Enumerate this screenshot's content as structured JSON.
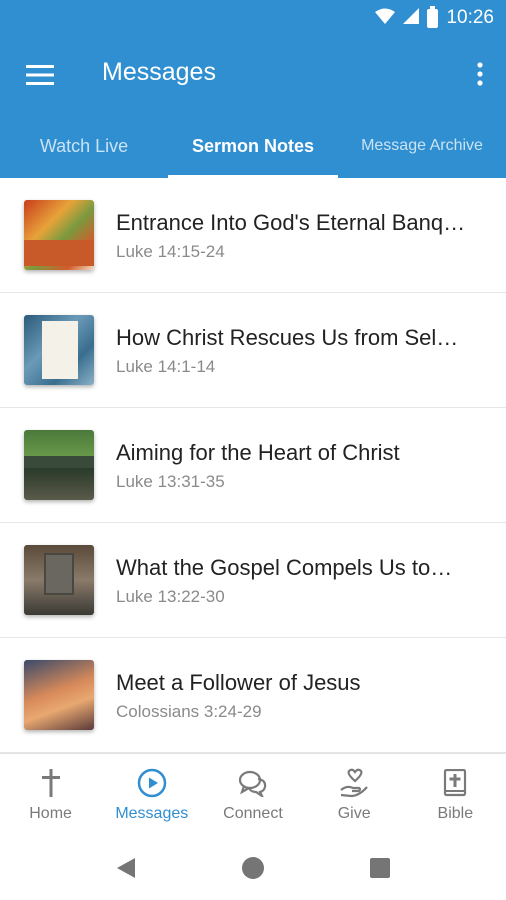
{
  "status_bar": {
    "time": "10:26",
    "icons": [
      "wifi-icon",
      "signal-icon",
      "battery-icon"
    ]
  },
  "app_bar": {
    "title": "Messages",
    "menu_icon": "hamburger-menu-icon",
    "overflow_icon": "more-vertical-icon"
  },
  "tabs": [
    {
      "label": "Watch Live",
      "active": false
    },
    {
      "label": "Sermon Notes",
      "active": true
    },
    {
      "label": "Message Archive",
      "active": false
    }
  ],
  "messages": [
    {
      "title": "Entrance Into God's Eternal Banq…",
      "reference": "Luke 14:15-24"
    },
    {
      "title": "How Christ Rescues Us from Sel…",
      "reference": "Luke 14:1-14"
    },
    {
      "title": "Aiming for the Heart of Christ",
      "reference": "Luke 13:31-35"
    },
    {
      "title": "What the Gospel Compels Us to…",
      "reference": "Luke 13:22-30"
    },
    {
      "title": "Meet a Follower of Jesus",
      "reference": "Colossians 3:24-29"
    }
  ],
  "bottom_nav": [
    {
      "label": "Home",
      "icon": "cross-icon",
      "active": false
    },
    {
      "label": "Messages",
      "icon": "play-circle-icon",
      "active": true
    },
    {
      "label": "Connect",
      "icon": "chat-bubbles-icon",
      "active": false
    },
    {
      "label": "Give",
      "icon": "heart-hand-icon",
      "active": false
    },
    {
      "label": "Bible",
      "icon": "bible-icon",
      "active": false
    }
  ],
  "colors": {
    "primary": "#2f8fd1",
    "text": "#222222",
    "secondary_text": "#8a8a8a",
    "inactive_nav": "#7a7a7a"
  }
}
